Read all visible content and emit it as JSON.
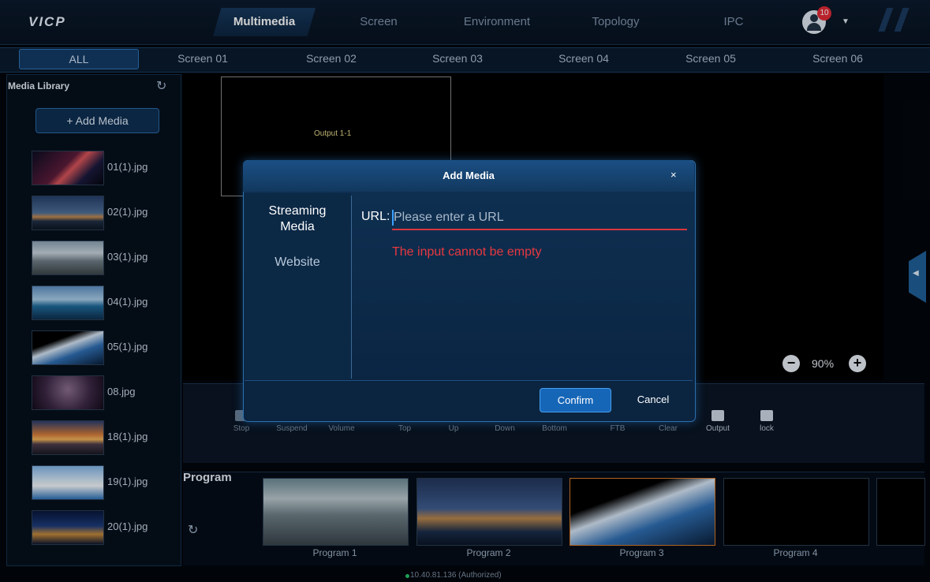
{
  "app": {
    "logo": "VICP"
  },
  "nav": {
    "tabs": [
      {
        "label": "Multimedia",
        "active": true
      },
      {
        "label": "Screen"
      },
      {
        "label": "Environment"
      },
      {
        "label": "Topology"
      },
      {
        "label": "IPC"
      }
    ],
    "notification_count": "10"
  },
  "screen_tabs": [
    "ALL",
    "Screen 01",
    "Screen 02",
    "Screen 03",
    "Screen 04",
    "Screen 05",
    "Screen 06"
  ],
  "sidebar": {
    "title": "Media Library",
    "add_button": "+ Add Media",
    "items": [
      {
        "name": "01(1).jpg"
      },
      {
        "name": "02(1).jpg"
      },
      {
        "name": "03(1).jpg"
      },
      {
        "name": "04(1).jpg"
      },
      {
        "name": "05(1).jpg"
      },
      {
        "name": "08.jpg"
      },
      {
        "name": "18(1).jpg"
      },
      {
        "name": "19(1).jpg"
      },
      {
        "name": "20(1).jpg"
      }
    ]
  },
  "canvas": {
    "output_label": "Output 1-1",
    "zoom": "90%"
  },
  "toolbar": {
    "items": [
      "Stop",
      "Suspend",
      "Volume",
      "Top",
      "Up",
      "Down",
      "Bottom",
      "FTB",
      "Clear",
      "Output",
      "lock"
    ]
  },
  "program": {
    "label": "Program",
    "items": [
      "Program 1",
      "Program 2",
      "Program 3",
      "Program 4"
    ]
  },
  "status": {
    "text": "10.40.81.136 (Authorized)"
  },
  "dialog": {
    "title": "Add Media",
    "close": "×",
    "tabs": [
      "Streaming Media",
      "Website"
    ],
    "url_label": "URL:",
    "url_placeholder": "Please enter a URL",
    "url_value": "",
    "error": "The input cannot be empty",
    "confirm": "Confirm",
    "cancel": "Cancel"
  }
}
